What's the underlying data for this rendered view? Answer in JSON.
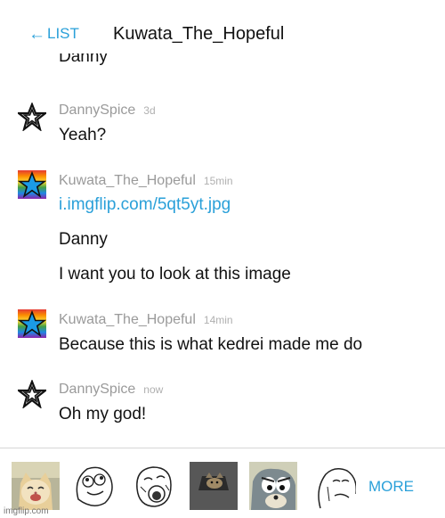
{
  "header": {
    "back_label": "LIST",
    "back_icon": "left-arrow-icon",
    "title": "Kuwata_The_Hopeful"
  },
  "partial_previous": "Danny",
  "messages": [
    {
      "user": "DannySpice",
      "time": "3d",
      "avatar": "outline-star-icon",
      "lines": [
        "Yeah?"
      ]
    },
    {
      "user": "Kuwata_The_Hopeful",
      "time": "15min",
      "avatar": "rainbow-star-icon",
      "link": "i.imgflip.com/5qt5yt.jpg",
      "lines": [
        "Danny",
        "I want you to look at this image"
      ]
    },
    {
      "user": "Kuwata_The_Hopeful",
      "time": "14min",
      "avatar": "rainbow-star-icon",
      "lines": [
        "Because this is what kedrei made me do"
      ]
    },
    {
      "user": "DannySpice",
      "time": "now",
      "avatar": "outline-star-icon",
      "lines": [
        "Oh my god!"
      ]
    }
  ],
  "stickers": [
    "happy-cat-sticker",
    "derp-face-sticker",
    "lol-face-sticker",
    "ceiling-cat-sticker",
    "tom-cat-sticker",
    "rage-face-sticker"
  ],
  "footer": {
    "more_label": "MORE",
    "watermark": "imgflip.com"
  },
  "colors": {
    "accent": "#2aa0d9",
    "text": "#111111",
    "muted": "#9a9a9a"
  }
}
